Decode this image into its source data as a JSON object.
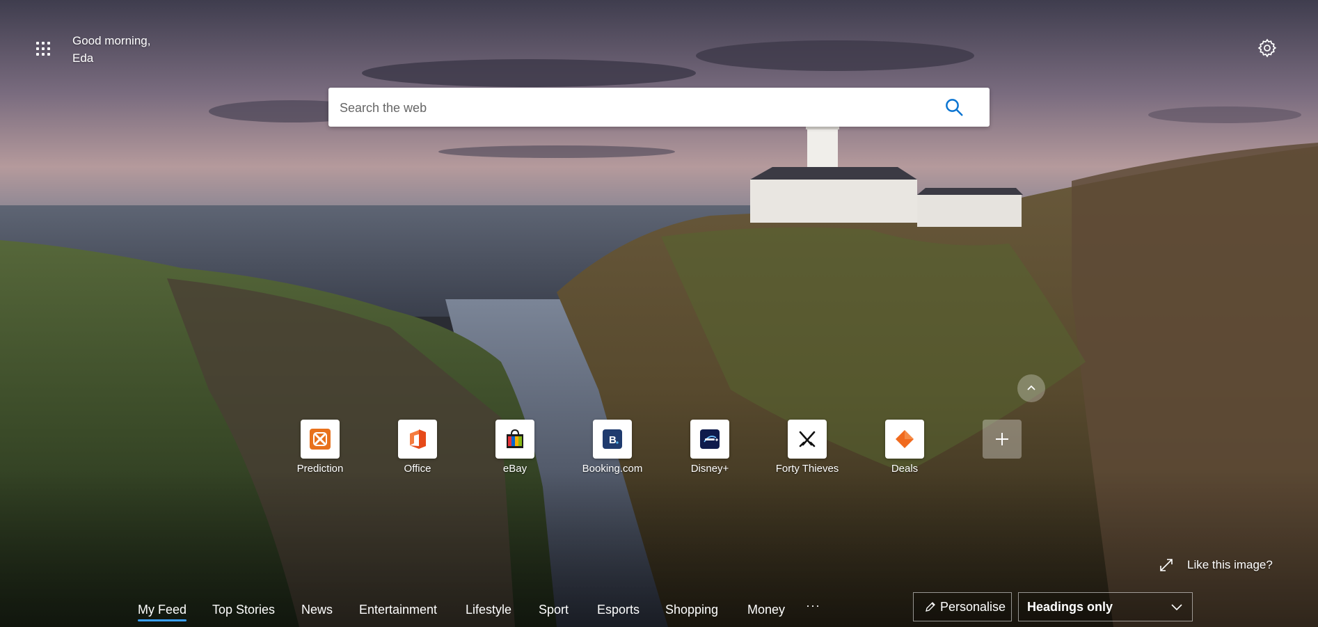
{
  "greeting": {
    "line1": "Good morning,",
    "line2": "Eda"
  },
  "search": {
    "placeholder": "Search the web"
  },
  "quick_links": [
    {
      "label": "Prediction",
      "icon": "prediction-icon",
      "color": "#e8711c"
    },
    {
      "label": "Office",
      "icon": "office-icon",
      "color": "#e64a19"
    },
    {
      "label": "eBay",
      "icon": "ebay-icon",
      "color": "#1a1a1a"
    },
    {
      "label": "Booking.com",
      "icon": "booking-icon",
      "color": "#1f3b6e"
    },
    {
      "label": "Disney+",
      "icon": "disney-plus-icon",
      "color": "#0f1b4c"
    },
    {
      "label": "Forty Thieves",
      "icon": "forty-thieves-icon",
      "color": "#111111"
    },
    {
      "label": "Deals",
      "icon": "deals-icon",
      "color": "#f06a1e"
    },
    {
      "label": "",
      "icon": "add-site-icon",
      "color": "#ffffff"
    }
  ],
  "like_image": {
    "label": "Like this image?"
  },
  "feed_nav": {
    "items": [
      {
        "label": "My Feed",
        "active": true
      },
      {
        "label": "Top Stories"
      },
      {
        "label": "News"
      },
      {
        "label": "Entertainment"
      },
      {
        "label": "Lifestyle"
      },
      {
        "label": "Sport"
      },
      {
        "label": "Esports"
      },
      {
        "label": "Shopping"
      },
      {
        "label": "Money"
      }
    ],
    "more": "···"
  },
  "personalise": {
    "label": "Personalise"
  },
  "layout_select": {
    "value": "Headings only"
  },
  "colors": {
    "accent": "#3aa0ff",
    "search_icon": "#0a74d1"
  }
}
